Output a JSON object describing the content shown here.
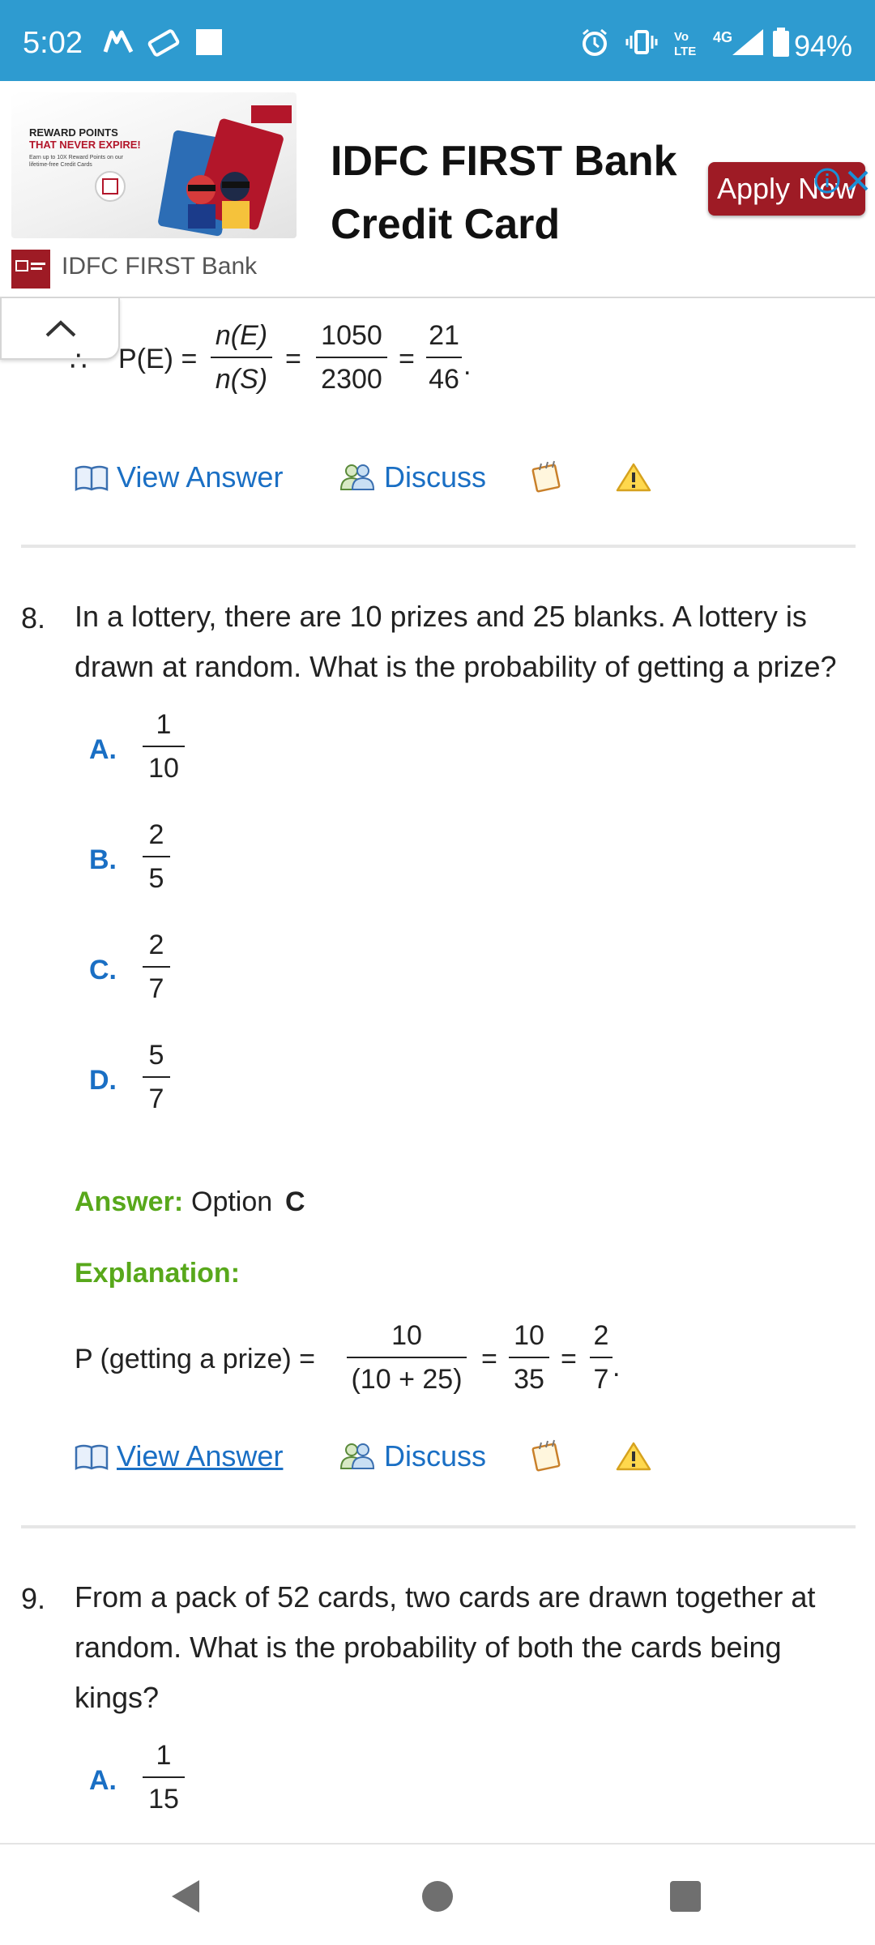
{
  "status_bar": {
    "time": "5:02",
    "battery": "94%",
    "network": "4G",
    "volte": "VoLTE",
    "icons": [
      "messenger-icon",
      "ticket-icon",
      "square-notification-icon",
      "alarm-icon",
      "vibrate-icon",
      "volte-icon",
      "signal-icon",
      "battery-icon"
    ]
  },
  "ad": {
    "promo_line1": "REWARD POINTS",
    "promo_line2": "THAT NEVER EXPIRE!",
    "promo_sub": "Earn up to 10X Reward Points on our lifetime-free Credit Cards",
    "headline_line1": "IDFC FIRST Bank",
    "headline_line2": "Credit Card",
    "cta": "Apply Now",
    "brand": "IDFC FIRST Bank",
    "brand_color": "#9e1b25"
  },
  "prev_question": {
    "lhs": "P(E) =",
    "frac1_num": "n(E)",
    "frac1_den": "n(S)",
    "eq1": "=",
    "frac2_num": "1050",
    "frac2_den": "2300",
    "eq2": "=",
    "frac3_num": "21",
    "frac3_den": "46",
    "therefore": "∴"
  },
  "actions": {
    "view_answer": "View Answer",
    "discuss": "Discuss"
  },
  "q8": {
    "number": "8.",
    "text": "In a lottery, there are 10 prizes and 25 blanks. A lottery is drawn at random. What is the probability of getting a prize?",
    "options": [
      {
        "letter": "A.",
        "num": "1",
        "den": "10"
      },
      {
        "letter": "B.",
        "num": "2",
        "den": "5"
      },
      {
        "letter": "C.",
        "num": "2",
        "den": "7"
      },
      {
        "letter": "D.",
        "num": "5",
        "den": "7"
      }
    ],
    "answer_label": "Answer:",
    "answer_text": "Option",
    "answer_option": "C",
    "explanation_label": "Explanation:",
    "expl_lhs": "P (getting a prize) =",
    "expl_frac1_num": "10",
    "expl_frac1_den": "(10 + 25)",
    "expl_eq1": "=",
    "expl_frac2_num": "10",
    "expl_frac2_den": "35",
    "expl_eq2": "=",
    "expl_frac3_num": "2",
    "expl_frac3_den": "7"
  },
  "q9": {
    "number": "9.",
    "text": "From a pack of 52 cards, two cards are drawn together at random. What is the probability of both the cards being kings?",
    "options": [
      {
        "letter": "A.",
        "num": "1",
        "den": "15"
      }
    ]
  },
  "colors": {
    "status_bar": "#2e9bd0",
    "link_blue": "#1a6fc4",
    "answer_green": "#58a81b",
    "ad_red": "#9e1b25"
  }
}
